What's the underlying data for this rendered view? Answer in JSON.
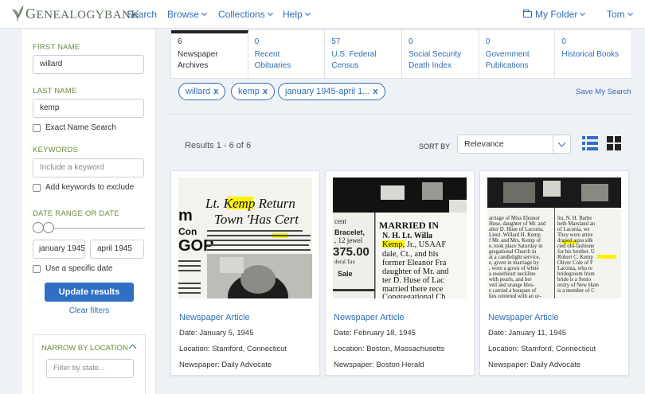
{
  "header": {
    "logo_text_big": "G",
    "logo_text_rest": "ENEALOGYBANK",
    "nav": [
      {
        "label": "Search"
      },
      {
        "label": "Browse"
      },
      {
        "label": "Collections"
      },
      {
        "label": "Help"
      }
    ],
    "my_folder": "My Folder",
    "user": "Tom"
  },
  "sidebar": {
    "first_name_label": "FIRST NAME",
    "first_name_value": "willard",
    "last_name_label": "LAST NAME",
    "last_name_value": "kemp",
    "exact_name_label": "Exact Name Search",
    "keywords_label": "KEYWORDS",
    "keywords_placeholder": "Include a keyword",
    "exclude_label": "Add keywords to exclude",
    "date_range_label": "DATE RANGE OR DATE",
    "date_from": "january 1945",
    "date_to": "april 1945",
    "specific_date_label": "Use a specific date",
    "update_button": "Update results",
    "clear_filters": "Clear filters",
    "location_title": "NARROW BY LOCATION",
    "location_placeholder": "Filter by state..."
  },
  "tabs": [
    {
      "count": "6",
      "name": "Newspaper Archives",
      "active": true
    },
    {
      "count": "0",
      "name": "Recent Obituaries"
    },
    {
      "count": "57",
      "name": "U.S. Federal Census"
    },
    {
      "count": "0",
      "name": "Social Security Death Index"
    },
    {
      "count": "0",
      "name": "Government Publications"
    },
    {
      "count": "0",
      "name": "Historical Books"
    }
  ],
  "chips": [
    {
      "label": "willard"
    },
    {
      "label": "kemp"
    },
    {
      "label": "january 1945-april 1..."
    }
  ],
  "save_search": "Save My Search",
  "results": {
    "count_text": "Results 1 - 6 of 6",
    "sort_label": "SORT BY",
    "sort_value": "Relevance"
  },
  "cards": [
    {
      "type": "Newspaper Article",
      "date": "Date: January 5, 1945",
      "location": "Location: Stamford, Connecticut",
      "newspaper": "Newspaper: Daily Advocate"
    },
    {
      "type": "Newspaper Article",
      "date": "Date: February 18, 1945",
      "location": "Location: Boston, Massachusetts",
      "newspaper": "Newspaper: Boston Herald"
    },
    {
      "type": "Newspaper Article",
      "date": "Date: January 11, 1945",
      "location": "Location: Stamford, Connecticut",
      "newspaper": "Newspaper: Daily Advocate"
    }
  ],
  "colors": {
    "accent": "#2f6db5",
    "label_green": "#6b8a3e",
    "highlight": "#fff200"
  }
}
